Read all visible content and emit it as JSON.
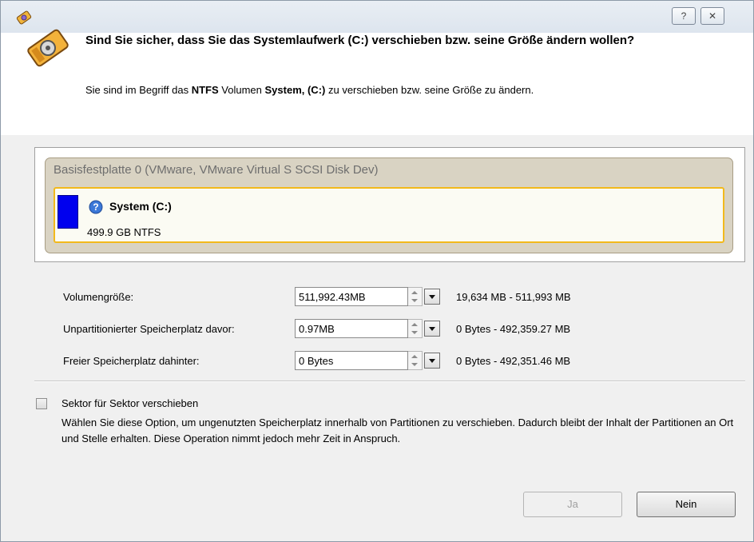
{
  "titlebar": {
    "help_label": "?",
    "close_label": "✕"
  },
  "header": {
    "title": "Sind Sie sicher, dass Sie das Systemlaufwerk (C:) verschieben bzw. seine Größe ändern wollen?",
    "subtitle_prefix": "Sie sind im Begriff das ",
    "subtitle_fs": "NTFS",
    "subtitle_mid": " Volumen ",
    "subtitle_volume": "System, (C:)",
    "subtitle_suffix": " zu verschieben bzw. seine Größe zu ändern."
  },
  "disk": {
    "title": "Basisfestplatte 0 (VMware, VMware Virtual S SCSI Disk Dev)",
    "partition": {
      "name": "System (C:)",
      "size": "499.9 GB NTFS",
      "color": "#0000ee"
    }
  },
  "fields": [
    {
      "label": "Volumengröße:",
      "value": "511,992.43MB",
      "range": "19,634 MB - 511,993 MB"
    },
    {
      "label": "Unpartitionierter Speicherplatz davor:",
      "value": "0.97MB",
      "range": "0 Bytes - 492,359.27 MB"
    },
    {
      "label": "Freier Speicherplatz dahinter:",
      "value": "0 Bytes",
      "range": "0 Bytes - 492,351.46 MB"
    }
  ],
  "option": {
    "label": "Sektor für Sektor verschieben",
    "checked": false,
    "description": "Wählen Sie diese Option, um ungenutzten Speicherplatz innerhalb von Partitionen zu verschieben. Dadurch bleibt der Inhalt der Partitionen an Ort und Stelle erhalten. Diese Operation nimmt jedoch mehr Zeit in Anspruch."
  },
  "buttons": {
    "yes": "Ja",
    "no": "Nein"
  }
}
